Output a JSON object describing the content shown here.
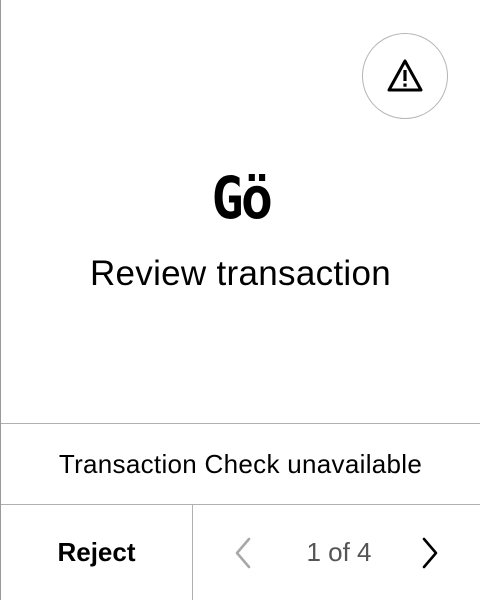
{
  "header": {
    "warning_icon": "warning-triangle-icon"
  },
  "token": {
    "logo_text": "Gö"
  },
  "main": {
    "title": "Review transaction"
  },
  "check": {
    "label": "Transaction Check unavailable"
  },
  "footer": {
    "reject_label": "Reject",
    "pager": {
      "current": 1,
      "total": 4,
      "label": "1 of 4",
      "prev_icon": "chevron-left-icon",
      "next_icon": "chevron-right-icon",
      "prev_enabled": false,
      "next_enabled": true
    }
  },
  "colors": {
    "background": "#ffffff",
    "text": "#000000",
    "muted_text": "#555555",
    "disabled_icon": "#a8a8a8",
    "divider": "#b0b0b0"
  }
}
